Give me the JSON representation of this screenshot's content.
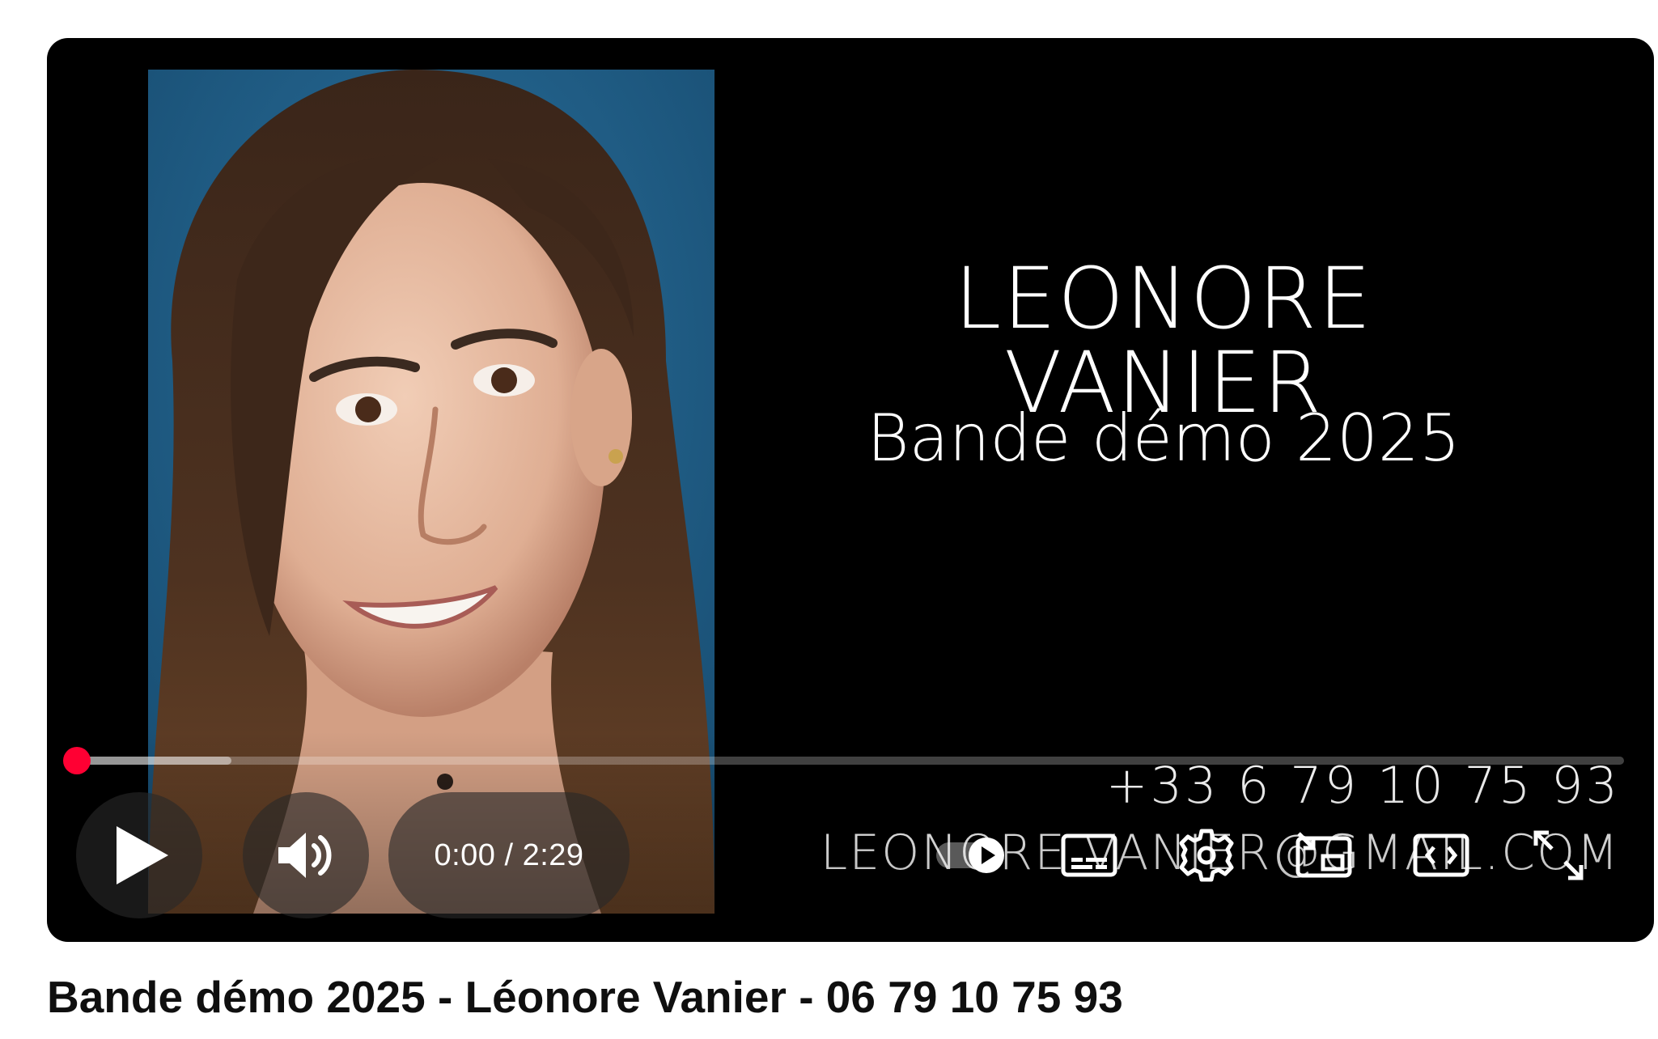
{
  "video": {
    "overlay": {
      "name": "LEONORE VANIER",
      "subtitle": "Bande démo 2025",
      "phone": "+33 6 79 10 75 93",
      "email": "LEONORE.VANIER@GMAIL.COM"
    },
    "progress": {
      "played_fraction": 0.0,
      "buffered_fraction": 0.1
    },
    "time_display": "0:00 / 2:29"
  },
  "controls": {
    "play": "play-icon",
    "volume": "volume-icon",
    "autoplay": "autoplay-toggle-icon",
    "captions": "subtitles-icon",
    "settings": "gear-icon",
    "miniplayer": "miniplayer-icon",
    "theater": "theater-mode-icon",
    "fullscreen": "fullscreen-icon"
  },
  "title": "Bande démo 2025 - Léonore Vanier - 06 79 10 75 93",
  "colors": {
    "accent": "#ff0033",
    "player_bg": "#000000",
    "title_text": "#0f0f0f"
  }
}
